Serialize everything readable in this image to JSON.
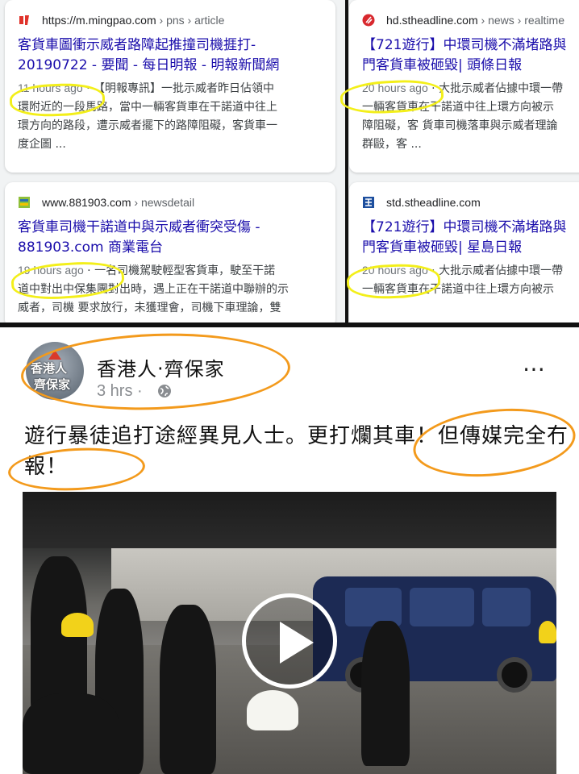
{
  "results": [
    {
      "favicon": "mingpao-logo-icon",
      "source": "https://m.mingpao.com",
      "path": " › pns › article",
      "title": "客貨車圖衝示威者路障起推撞司機捱打-\n20190722 - 要聞 - 每日明報 - 明報新聞網",
      "ago": "11 hours ago",
      "snippet": " · 【明報專訊】一批示威者昨日佔領中\n環附近的一段馬路，當中一輛客貨車在干諾道中往上\n環方向的路段，遭示威者擺下的路障阻礙，客貨車一\n度企圖 ..."
    },
    {
      "favicon": "headline-logo-icon",
      "source": "hd.stheadline.com",
      "path": " › news › realtime",
      "title": "【721遊行】中環司機不滿堵路與\n門客貨車被砸毀| 頭條日報",
      "ago": "20 hours ago",
      "snippet": " · 大批示威者佔據中環一帶\n一輛客貨車在干諾道中往上環方向被示\n障阻礙，客 貨車司機落車與示威者理論\n群毆，客 ..."
    },
    {
      "favicon": "881903-logo-icon",
      "source": "www.881903.com",
      "path": " › newsdetail",
      "title": "客貨車司機干諾道中與示威者衝突受傷 -\n881903.com 商業電台",
      "ago": "19 hours ago",
      "snippet": " · 一名司機駕駛輕型客貨車，駛至干諾\n道中對出中保集團對出時，遇上正在干諾道中聯辦的示\n威者，司機 要求放行，未獲理會，司機下車理論，雙"
    },
    {
      "favicon": "singtao-logo-icon",
      "source": "std.stheadline.com",
      "path": "",
      "title": "【721遊行】中環司機不滿堵路與\n門客貨車被砸毀| 星島日報",
      "ago": "20 hours ago",
      "snippet": " · 大批示威者佔據中環一帶\n一輛客貨車在干諾道中往上環方向被示"
    }
  ],
  "post": {
    "avatar_text_1": "香港人",
    "avatar_text_2": "齊保家",
    "author": "香港人‧齊保家",
    "time": "3 hrs ·",
    "more_icon": "⋯",
    "text": "遊行暴徒追打途經異見人士。更打爛其車！但傳媒完全冇報！",
    "video_play_icon": "play-icon"
  },
  "colors": {
    "link": "#1a0dab",
    "highlight_yellow": "#f3ef1a",
    "highlight_orange": "#f39a1c"
  }
}
